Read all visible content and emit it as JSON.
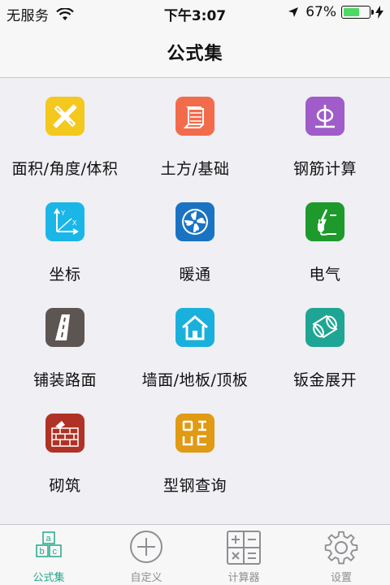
{
  "status": {
    "carrier": "无服务",
    "time": "下午3:07",
    "battery": "67%",
    "battery_level": 0.67
  },
  "nav": {
    "title": "公式集"
  },
  "items": [
    {
      "label": "面积/角度/体积",
      "icon": "ruler-pencil-icon",
      "color": "#f4c81d"
    },
    {
      "label": "土方/基础",
      "icon": "foundation-icon",
      "color": "#f26b4b"
    },
    {
      "label": "钢筋计算",
      "icon": "rebar-icon",
      "color": "#a05cc8"
    },
    {
      "label": "坐标",
      "icon": "xy-axis-icon",
      "color": "#1ab6e8"
    },
    {
      "label": "暖通",
      "icon": "fan-icon",
      "color": "#1a73c2"
    },
    {
      "label": "电气",
      "icon": "electric-plug-icon",
      "color": "#1e9a2c"
    },
    {
      "label": "铺装路面",
      "icon": "road-icon",
      "color": "#5d5551"
    },
    {
      "label": "墙面/地板/顶板",
      "icon": "house-icon",
      "color": "#1ab0dc"
    },
    {
      "label": "钣金展开",
      "icon": "sheet-metal-icon",
      "color": "#1fa593"
    },
    {
      "label": "砌筑",
      "icon": "brick-wall-icon",
      "color": "#b03226"
    },
    {
      "label": "型钢查询",
      "icon": "steel-section-icon",
      "color": "#e09a13"
    }
  ],
  "tabs": [
    {
      "label": "公式集",
      "icon": "abc-blocks-icon",
      "active": true
    },
    {
      "label": "自定义",
      "icon": "plus-circle-icon",
      "active": false
    },
    {
      "label": "计算器",
      "icon": "calculator-icon",
      "active": false
    },
    {
      "label": "设置",
      "icon": "gear-icon",
      "active": false
    }
  ],
  "colors": {
    "accent": "#22a88a",
    "inactive": "#8e8e93",
    "battery": "#4cd964"
  }
}
